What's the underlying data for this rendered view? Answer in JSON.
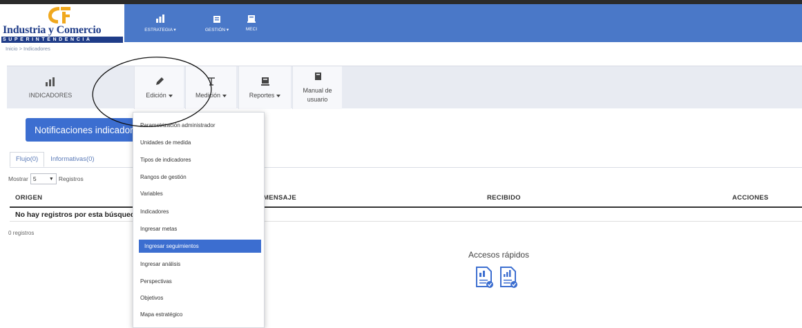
{
  "brand": {
    "logo_initials": "IC",
    "name_line1": "Industria y Comercio",
    "name_line2": "SUPERINTENDENCIA"
  },
  "topnav": [
    {
      "label": "ESTRATEGIA ▾",
      "icon": "strategy-icon"
    },
    {
      "label": "GESTIÓN ▾",
      "icon": "management-icon"
    },
    {
      "label": "MECI",
      "icon": "meci-icon"
    }
  ],
  "breadcrumb": "Inicio > Indicadores",
  "module": {
    "home_label": "INDICADORES",
    "buttons": {
      "edicion": "Edición",
      "medicion": "Medición",
      "reportes": "Reportes",
      "manual_line1": "Manual de",
      "manual_line2": "usuario"
    }
  },
  "notifications_button": "Notificaciones indicadores",
  "tabs": [
    "Flujo(0)",
    "Informativas(0)"
  ],
  "mostrar": {
    "prefix": "Mostrar",
    "value": "5",
    "suffix": "Registros"
  },
  "table": {
    "headers": [
      "ORIGEN",
      "MENSAJE",
      "RECIBIDO",
      "ACCIONES"
    ],
    "empty_text": "No hay registros por esta búsqueda",
    "count": "0 registros"
  },
  "quick_access": {
    "title": "Accesos rápidos"
  },
  "dropdown": {
    "items": [
      "Parametrización administrador",
      "Unidades de medida",
      "Tipos de indicadores",
      "Rangos de gestión",
      "Variables",
      "Indicadores",
      "Ingresar metas",
      "Ingresar seguimientos",
      "Ingresar análisis",
      "Perspectivas",
      "Objetivos",
      "Mapa estratégico"
    ],
    "active_item": "Ingresar seguimientos"
  },
  "colors": {
    "header": "#4a78c8",
    "primary": "#3c6ed0",
    "module_bar": "#e8ebf2",
    "brand_blue": "#1f3c88",
    "brand_gold": "#f0a81e"
  }
}
